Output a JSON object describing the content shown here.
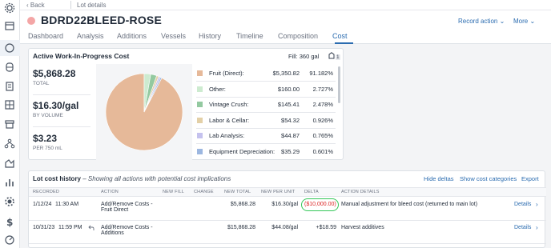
{
  "nav": {
    "back_label": "Back",
    "breadcrumb": "Lot details"
  },
  "rail_icons": [
    "settings-icon",
    "calendar-icon",
    "circle-icon",
    "barrel-icon",
    "clipboard-icon",
    "grid-icon",
    "archive-icon",
    "network-icon",
    "chart-area-icon",
    "bar-chart-icon",
    "cog-icon",
    "dollar-icon",
    "gauge-icon"
  ],
  "header": {
    "lot_code": "BDRD22BLEED-ROSE",
    "record_action": "Record action",
    "more": "More",
    "dot_color": "#f4a6a6"
  },
  "tabs": [
    "Dashboard",
    "Analysis",
    "Additions",
    "Vessels",
    "History",
    "Timeline",
    "Composition",
    "Cost"
  ],
  "active_tab": "Cost",
  "wip": {
    "title": "Active Work-In-Progress Cost",
    "fill_label": "Fill:",
    "fill_value": "360 gal",
    "badge_count": "1",
    "stats": [
      {
        "value": "$5,868.28",
        "label": "TOTAL"
      },
      {
        "value": "$16.30/gal",
        "label": "BY VOLUME"
      },
      {
        "value": "$3.23",
        "label": "PER 750 mL"
      }
    ]
  },
  "chart_data": {
    "type": "pie",
    "title": "",
    "slices": [
      {
        "name": "Fruit (Direct):",
        "amount": "$5,350.82",
        "pct_label": "91.182%",
        "value": 91.182,
        "color": "#e6b999"
      },
      {
        "name": "Other:",
        "amount": "$160.00",
        "pct_label": "2.727%",
        "value": 2.727,
        "color": "#cdebd0"
      },
      {
        "name": "Vintage Crush:",
        "amount": "$145.41",
        "pct_label": "2.478%",
        "value": 2.478,
        "color": "#93c9a0"
      },
      {
        "name": "Labor & Cellar:",
        "amount": "$54.32",
        "pct_label": "0.926%",
        "value": 0.926,
        "color": "#e3d0a7"
      },
      {
        "name": "Lab Analysis:",
        "amount": "$44.87",
        "pct_label": "0.765%",
        "value": 0.765,
        "color": "#c5c2ee"
      },
      {
        "name": "Equipment Depreciation:",
        "amount": "$35.29",
        "pct_label": "0.601%",
        "value": 0.601,
        "color": "#9cb7e0"
      }
    ]
  },
  "history": {
    "title": "Lot cost history",
    "subtitle": "– Showing all actions with potential cost implications",
    "links": [
      "Hide deltas",
      "Show cost categories",
      "Export"
    ],
    "columns": [
      "RECORDED",
      "ACTION",
      "NEW FILL",
      "CHANGE",
      "NEW TOTAL",
      "NEW PER UNIT",
      "DELTA",
      "ACTION DETAILS"
    ],
    "rows": [
      {
        "date": "1/12/24",
        "time": "11:30 AM",
        "action_line1": "Add/Remove Costs -",
        "action_line2": "Fruit Direct",
        "new_fill": "",
        "change": "",
        "new_total": "$5,868.28",
        "new_per_unit": "$16.30/gal",
        "delta": "($10,000.00)",
        "details": "Manual adjustment for bleed cost (returned to main lot)",
        "details_link": "Details"
      },
      {
        "date": "10/31/23",
        "time": "11:59 PM",
        "action_line1": "Add/Remove Costs -",
        "action_line2": "Additions",
        "new_fill": "",
        "change": "",
        "new_total": "$15,868.28",
        "new_per_unit": "$44.08/gal",
        "delta": "+$18.59",
        "details": "Harvest additives",
        "details_link": "Details"
      }
    ]
  }
}
